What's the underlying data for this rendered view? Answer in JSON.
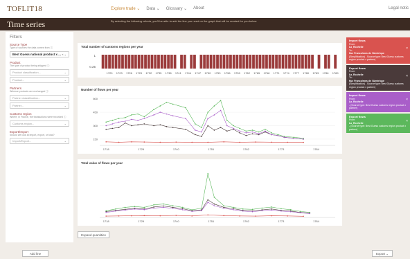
{
  "nav": {
    "logo": "TOFLIT18",
    "links": [
      "Explore trade ⌄",
      "Data ⌄",
      "Glossary ⌄",
      "About"
    ],
    "legal": "Legal notic"
  },
  "banner": {
    "title": "Time series",
    "description": "By selecting the following criteria, you'll be able to add the line you need on the graph that will be created for you below."
  },
  "sidebar": {
    "heading": "Filters",
    "source_label": "Source Type",
    "source_sub": "Type of sources the data comes from",
    "source_value": "Best Guess national product x ...",
    "product_label": "Product",
    "product_sub": "The type of product being shipped",
    "product_classification": "Product classification...",
    "product_value": "Product...",
    "partners_label": "Partners",
    "partners_sub": "Whence products are exchanged",
    "partner_classification": "Partner classification...",
    "partner_value": "Partner...",
    "customs_label": "Customs region",
    "customs_sub": "Where, in France, the transactions were recorded",
    "customs_value": "Customs region...",
    "export_label": "Export/Import",
    "export_sub": "Should we look at import, export, or total?",
    "export_value": "Import/Export...",
    "add_line": "Add line"
  },
  "panels": {
    "regions_title": "Total number of customs regions per year",
    "flows_title": "Number of flows per year",
    "value_title": "Total value of flows per year",
    "expand_button": "Expand quantities"
  },
  "cards": [
    {
      "type": "Import flows",
      "from": "From:",
      "region": "La_Rochelle",
      "to": "To:",
      "partner": "flux Franco/mes de l'Amérique",
      "note": "(Simplification) - Source type: Best Guess customs region product x partner)",
      "color": "#d9534f"
    },
    {
      "type": "Export flows",
      "from": "From:",
      "region": "La_Rochelle",
      "to": "To:",
      "partner": "flux Franco/mes de l'Amérique",
      "note": "(Simplification) - Source type: Best Guess customs region product x partner)",
      "color": "#4a3a3a"
    },
    {
      "type": "Import flows",
      "from": "From:",
      "region": "La_Rochelle",
      "to": "",
      "partner": "",
      "note": "- (Source type: Best Guess customs region product x partner)",
      "color": "#a95ec9"
    },
    {
      "type": "Export flows",
      "from": "From:",
      "region": "La_Rochelle",
      "to": "",
      "partner": "",
      "note": "- (Source type: Best Guess customs region product x partner)",
      "color": "#5cb85c"
    }
  ],
  "export_button": "Export ⌄",
  "chart_data": [
    {
      "type": "bar",
      "title": "Total number of customs regions per year",
      "x_ticks": [
        "1720",
        "1723",
        "1726",
        "1729",
        "1732",
        "1735",
        "1738",
        "1741",
        "1744",
        "1747",
        "1750",
        "1753",
        "1756",
        "1759",
        "1762",
        "1765",
        "1768",
        "1771",
        "1774",
        "1777",
        "1780",
        "1783",
        "1786",
        "1789"
      ],
      "y_ticks": [
        "1",
        "0.25"
      ],
      "years_present": [
        1718,
        1719,
        1720,
        1721,
        1722,
        1723,
        1724,
        1725,
        1726,
        1727,
        1728,
        1729,
        1730,
        1731,
        1732,
        1733,
        1734,
        1735,
        1736,
        1737,
        1738,
        1739,
        1740,
        1742,
        1743,
        1745,
        1746,
        1748,
        1749,
        1750,
        1751,
        1752,
        1753,
        1754,
        1755,
        1756,
        1757,
        1758,
        1759,
        1760,
        1761,
        1762,
        1763,
        1764,
        1765,
        1766,
        1767,
        1768,
        1769,
        1770,
        1771,
        1772,
        1773,
        1774,
        1775,
        1776,
        1777,
        1778,
        1779,
        1780,
        1781,
        1782,
        1784,
        1786,
        1787,
        1789
      ],
      "value": 1
    },
    {
      "type": "line",
      "title": "Number of flows per year",
      "x_ticks": [
        "1718",
        "1729",
        "1740",
        "1751",
        "1762",
        "1773",
        "1784"
      ],
      "y_ticks": [
        "600",
        "450",
        "300",
        "150"
      ],
      "ylim": [
        80,
        620
      ],
      "xlim": [
        1716,
        1790
      ],
      "series": [
        {
          "color": "#4a3a3a",
          "x": [
            1718,
            1720,
            1722,
            1724,
            1726,
            1728,
            1730,
            1733,
            1735,
            1737,
            1739,
            1743,
            1746,
            1748,
            1750,
            1752,
            1754,
            1756,
            1758,
            1760,
            1762,
            1764,
            1766,
            1768,
            1770,
            1772,
            1774,
            1777,
            1780
          ],
          "y": [
            260,
            270,
            280,
            330,
            300,
            310,
            320,
            300,
            310,
            290,
            280,
            260,
            200,
            180,
            300,
            250,
            280,
            240,
            260,
            220,
            190,
            210,
            200,
            230,
            200,
            190,
            170,
            160,
            150
          ]
        },
        {
          "color": "#5cb85c",
          "x": [
            1718,
            1720,
            1722,
            1724,
            1726,
            1728,
            1730,
            1733,
            1735,
            1737,
            1739,
            1743,
            1746,
            1748,
            1750,
            1752,
            1754,
            1756,
            1758,
            1760,
            1762,
            1764,
            1766,
            1768,
            1770,
            1772,
            1774,
            1777,
            1780
          ],
          "y": [
            340,
            360,
            380,
            390,
            420,
            430,
            400,
            480,
            520,
            560,
            540,
            500,
            320,
            280,
            450,
            520,
            580,
            360,
            300,
            270,
            240,
            250,
            230,
            260,
            220,
            200,
            180,
            170,
            160
          ]
        },
        {
          "color": "#a95ec9",
          "x": [
            1718,
            1720,
            1722,
            1724,
            1726,
            1728,
            1730,
            1733,
            1735,
            1737,
            1739,
            1743,
            1746,
            1748,
            1750,
            1752,
            1754,
            1756,
            1758,
            1760,
            1762,
            1764,
            1766,
            1768,
            1770,
            1772,
            1774,
            1777,
            1780
          ],
          "y": [
            300,
            320,
            340,
            350,
            370,
            360,
            380,
            420,
            450,
            430,
            410,
            380,
            250,
            230,
            380,
            420,
            470,
            300,
            270,
            240,
            220,
            230,
            210,
            240,
            200,
            190,
            170,
            160,
            150
          ]
        },
        {
          "color": "#d9534f",
          "x": [
            1718,
            1722,
            1726,
            1730,
            1735,
            1740,
            1745,
            1750,
            1755,
            1760,
            1765,
            1770,
            1775,
            1780
          ],
          "y": [
            120,
            115,
            120,
            118,
            115,
            117,
            115,
            115,
            120,
            115,
            118,
            116,
            115,
            114
          ]
        }
      ]
    },
    {
      "type": "line",
      "title": "Total value of flows per year",
      "x_ticks": [
        "1718",
        "1729",
        "1740",
        "1751",
        "1762",
        "1773",
        "1784"
      ],
      "y_ticks": [
        "25,000k",
        "20,000k",
        "15,000k",
        "10,000k",
        "5,000k"
      ],
      "ylim": [
        0,
        28000
      ],
      "xlim": [
        1716,
        1790
      ],
      "series": [
        {
          "color": "#4a3a3a",
          "x": [
            1718,
            1721,
            1724,
            1727,
            1730,
            1733,
            1736,
            1739,
            1742,
            1745,
            1748,
            1750,
            1752,
            1755,
            1758,
            1761,
            1764,
            1767,
            1770,
            1773,
            1776,
            1779,
            1782
          ],
          "y": [
            3500,
            4200,
            4800,
            5500,
            5000,
            6200,
            6800,
            6000,
            5200,
            4000,
            4500,
            10500,
            8000,
            6000,
            5200,
            4200,
            3800,
            4500,
            5000,
            4200,
            3800,
            3000,
            2500
          ]
        },
        {
          "color": "#5cb85c",
          "x": [
            1718,
            1721,
            1724,
            1727,
            1730,
            1733,
            1736,
            1739,
            1742,
            1745,
            1748,
            1750,
            1752,
            1755,
            1758,
            1761,
            1764,
            1767,
            1770,
            1773,
            1776,
            1779,
            1782
          ],
          "y": [
            4000,
            5000,
            6000,
            6500,
            6000,
            7500,
            8000,
            7000,
            6000,
            4500,
            5500,
            26000,
            12000,
            7000,
            6000,
            5000,
            4800,
            5600,
            6200,
            5200,
            4600,
            3600,
            3000
          ]
        },
        {
          "color": "#a95ec9",
          "x": [
            1718,
            1721,
            1724,
            1727,
            1730,
            1733,
            1736,
            1739,
            1742,
            1745,
            1748,
            1750,
            1752,
            1755,
            1758,
            1761,
            1764,
            1767,
            1770,
            1773,
            1776,
            1779,
            1782
          ],
          "y": [
            3000,
            3800,
            4400,
            5000,
            4600,
            5600,
            6000,
            5400,
            4600,
            3600,
            4000,
            9000,
            7000,
            5400,
            4600,
            3800,
            3400,
            4000,
            4400,
            3800,
            3400,
            2800,
            2300
          ]
        },
        {
          "color": "#d9534f",
          "x": [
            1718,
            1722,
            1726,
            1730,
            1735,
            1740,
            1745,
            1750,
            1755,
            1760,
            1765,
            1770,
            1775,
            1780
          ],
          "y": [
            800,
            900,
            1000,
            1100,
            1000,
            1200,
            900,
            1500,
            1100,
            900,
            800,
            1000,
            900,
            700
          ]
        }
      ]
    }
  ]
}
